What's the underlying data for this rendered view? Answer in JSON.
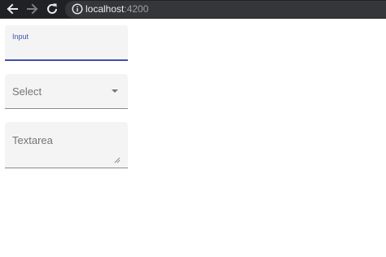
{
  "browser": {
    "url_host": "localhost",
    "url_port": ":4200",
    "toolbar_color": "#202124",
    "omnibox_color": "#35363a",
    "icons": [
      "arrow-left-icon",
      "arrow-right-icon",
      "reload-icon",
      "info-icon"
    ]
  },
  "form": {
    "accent_color": "#3f51b5",
    "field_background": "#f4f4f4",
    "input_label": "Input",
    "input_value": "",
    "select_label": "Select",
    "textarea_label": "Textarea"
  }
}
